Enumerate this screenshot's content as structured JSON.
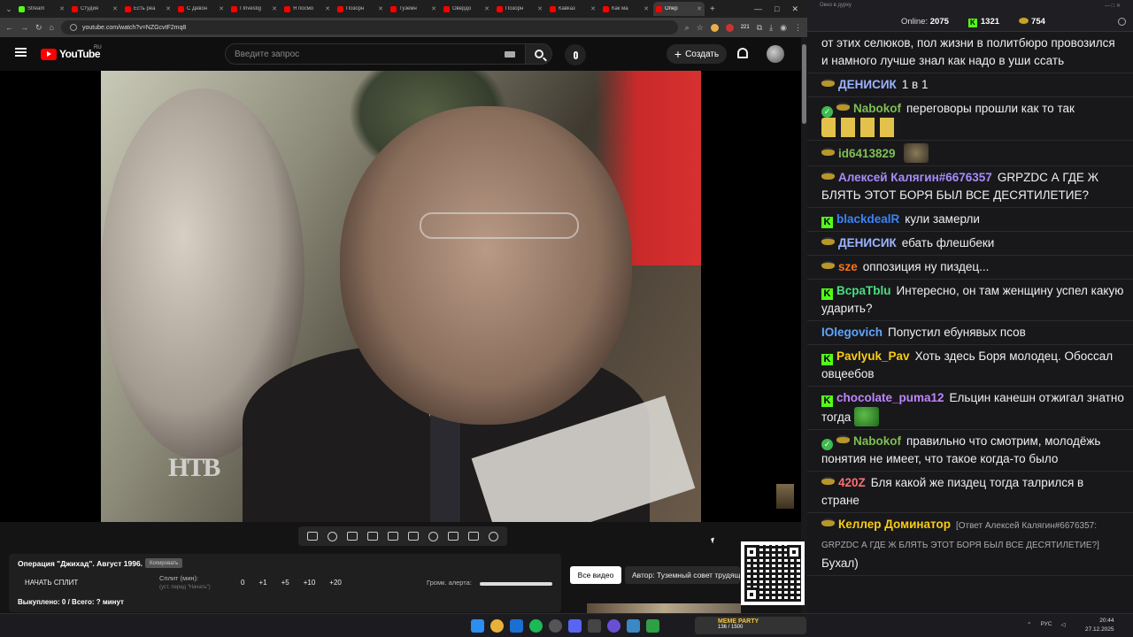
{
  "browser": {
    "tabs": [
      {
        "label": "Stream",
        "color": "#53fc18",
        "active": false
      },
      {
        "label": "Студия",
        "color": "#ff0000",
        "active": false
      },
      {
        "label": "Есть реа",
        "color": "#ff0000",
        "active": false
      },
      {
        "label": "С Девон",
        "color": "#ff0000",
        "active": false
      },
      {
        "label": "I Investig",
        "color": "#ff0000",
        "active": false
      },
      {
        "label": "Я посмо",
        "color": "#ff0000",
        "active": false
      },
      {
        "label": "Позорн",
        "color": "#ff0000",
        "active": false
      },
      {
        "label": "Туземн",
        "color": "#ff0000",
        "active": false
      },
      {
        "label": "Овердо",
        "color": "#ff0000",
        "active": false
      },
      {
        "label": "Позорн",
        "color": "#ff0000",
        "active": false
      },
      {
        "label": "Кавказ",
        "color": "#ff0000",
        "active": false
      },
      {
        "label": "Как ма",
        "color": "#ff0000",
        "active": false
      },
      {
        "label": "Опер",
        "color": "#ff0000",
        "active": true
      }
    ],
    "url": "youtube.com/watch?v=NZGcvtF2mq8",
    "badge_count": "221"
  },
  "youtube": {
    "logo": "YouTube",
    "region": "RU",
    "search_placeholder": "Введите запрос",
    "create_label": "Создать"
  },
  "video": {
    "watermark": "НТВ"
  },
  "overlay": {
    "title": "Операция \"Джихад\". Август 1996.",
    "copy_label": "Копировать",
    "start_split": "НАЧАТЬ СПЛИТ",
    "split_label": "Сплит (мин):",
    "split_sub": "(уст. перед \"Начать\")",
    "split_values": [
      "0",
      "+1",
      "+5",
      "+10",
      "+20"
    ],
    "volume_label": "Громк. алерта:",
    "stats": "Выкуплено: 0 / Всего: ? минут",
    "all_videos": "Все видео",
    "author": "Автор: Туземный совет трудящ"
  },
  "chat": {
    "window_title": "Окно в дурку",
    "online_label": "Online:",
    "online_count": "2075",
    "kick_count": "1321",
    "coin_count": "754",
    "messages": [
      {
        "name": "",
        "color": "#efeff1",
        "text": "от этих селюков, пол жизни в политбюро провозился и намного лучше знал как надо в уши ссать",
        "badges": [],
        "emote": ""
      },
      {
        "name": "ДЕНИСИК",
        "color": "#9db3ff",
        "text": "1 в 1",
        "badges": [
          "hat"
        ],
        "emote": ""
      },
      {
        "name": "Nabokof",
        "color": "#7fbf52",
        "text": "переговоры прошли как то так",
        "badges": [
          "check",
          "hat"
        ],
        "emote": "hands"
      },
      {
        "name": "id6413829",
        "color": "#7fbf52",
        "text": "",
        "badges": [
          "hat"
        ],
        "emote": "cat"
      },
      {
        "name": "Алексей Калягин#6676357",
        "color": "#a78bfa",
        "text": "GRPZDC А ГДЕ Ж БЛЯТЬ ЭТОТ БОРЯ БЫЛ ВСЕ ДЕСЯТИЛЕТИЕ?",
        "badges": [
          "hat"
        ],
        "emote": ""
      },
      {
        "name": "blackdealR",
        "color": "#3b82f6",
        "text": "кули замерли",
        "badges": [
          "kick"
        ],
        "emote": ""
      },
      {
        "name": "ДЕНИСИК",
        "color": "#9db3ff",
        "text": "ебать флешбеки",
        "badges": [
          "hat"
        ],
        "emote": ""
      },
      {
        "name": "sze",
        "color": "#f97316",
        "text": "оппозиция ну пиздец...",
        "badges": [
          "hat"
        ],
        "emote": ""
      },
      {
        "name": "BcpaTblu",
        "color": "#4ade80",
        "text": "Интересно, он там женщину успел какую ударить?",
        "badges": [
          "kick"
        ],
        "emote": ""
      },
      {
        "name": "IOlegovich",
        "color": "#60a5fa",
        "text": "Попустил ебунявых псов",
        "badges": [],
        "emote": ""
      },
      {
        "name": "Pavlyuk_Pav",
        "color": "#facc15",
        "text": "Хоть здесь Боря молодец. Обоссал овцеебов",
        "badges": [
          "kick"
        ],
        "emote": ""
      },
      {
        "name": "chocolate_puma12",
        "color": "#c084fc",
        "text": "Ельцин канешн отжигал знатно тогда",
        "badges": [
          "kick"
        ],
        "emote": "pepe"
      },
      {
        "name": "Nabokof",
        "color": "#7fbf52",
        "text": "правильно что смотрим, молодёжь понятия не имеет, что такое когда-то было",
        "badges": [
          "check",
          "hat"
        ],
        "emote": ""
      },
      {
        "name": "420Z",
        "color": "#f87171",
        "text": "Бля какой же пиздец тогда талрился в стране",
        "badges": [
          "hat"
        ],
        "emote": ""
      },
      {
        "name": "Келлер Доминатор",
        "color": "#facc15",
        "text": "Бухал)",
        "badges": [
          "hat"
        ],
        "emote": "",
        "reply": "[Ответ Алексей Калягин#6676357: GRPZDC А ГДЕ Ж БЛЯТЬ ЭТОТ БОРЯ БЫЛ ВСЕ ДЕСЯТИЛЕТИЕ?]"
      }
    ]
  },
  "taskbar": {
    "game_name": "MEME PARTY",
    "game_sub": "136 / 1500",
    "lang": "РУС",
    "time": "20:44",
    "date": "27.12.2025"
  }
}
